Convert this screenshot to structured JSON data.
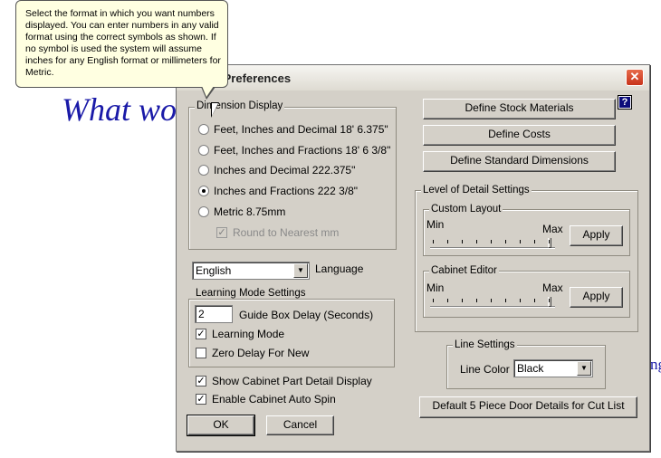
{
  "background": {
    "title": "What wo",
    "right_fragment": "ng"
  },
  "dialog": {
    "title": "/Preferences",
    "close_glyph": "✕",
    "help_glyph": "?"
  },
  "tooltip": {
    "text": "Select the format in which you want numbers displayed. You can enter numbers in any valid format using the correct symbols as shown. If no symbol is used the system will assume inches for any English format or millimeters for Metric."
  },
  "dimension_display": {
    "legend": "Dimension Display",
    "options": [
      {
        "label": "Feet, Inches and Decimal 18' 6.375\"",
        "selected": false
      },
      {
        "label": "Feet, Inches and Fractions 18' 6 3/8\"",
        "selected": false
      },
      {
        "label": "Inches and Decimal 222.375\"",
        "selected": false
      },
      {
        "label": "Inches and Fractions 222 3/8\"",
        "selected": true
      },
      {
        "label": "Metric 8.75mm",
        "selected": false
      }
    ],
    "round_mm": {
      "label": "Round to Nearest mm",
      "checked": true,
      "disabled": true
    }
  },
  "language": {
    "value": "English",
    "label": "Language"
  },
  "learning_mode": {
    "legend": "Learning Mode Settings",
    "delay_value": "2",
    "delay_label": "Guide Box Delay (Seconds)",
    "learning_mode": {
      "label": "Learning Mode",
      "checked": true
    },
    "zero_delay": {
      "label": "Zero Delay For New",
      "checked": false
    }
  },
  "options": {
    "show_part_detail": {
      "label": "Show Cabinet Part Detail Display",
      "checked": true
    },
    "auto_spin": {
      "label": "Enable Cabinet Auto Spin",
      "checked": true
    }
  },
  "buttons": {
    "ok": "OK",
    "cancel": "Cancel",
    "define_stock": "Define Stock Materials",
    "define_costs": "Define Costs",
    "define_dims": "Define Standard Dimensions",
    "door_details": "Default 5 Piece Door Details for Cut List"
  },
  "level_of_detail": {
    "legend": "Level of Detail Settings",
    "custom_layout": {
      "legend": "Custom Layout",
      "min": "Min",
      "max": "Max",
      "apply": "Apply",
      "level": 1.0
    },
    "cabinet_editor": {
      "legend": "Cabinet Editor",
      "min": "Min",
      "max": "Max",
      "apply": "Apply",
      "level": 1.0
    }
  },
  "line_settings": {
    "legend": "Line Settings",
    "color_label": "Line Color",
    "color_value": "Black"
  },
  "colors": {
    "title_text": "#1a1aa8",
    "tooltip_bg": "#ffffe1",
    "dialog_bg": "#d4d0c8",
    "close_red": "#c8341b"
  }
}
